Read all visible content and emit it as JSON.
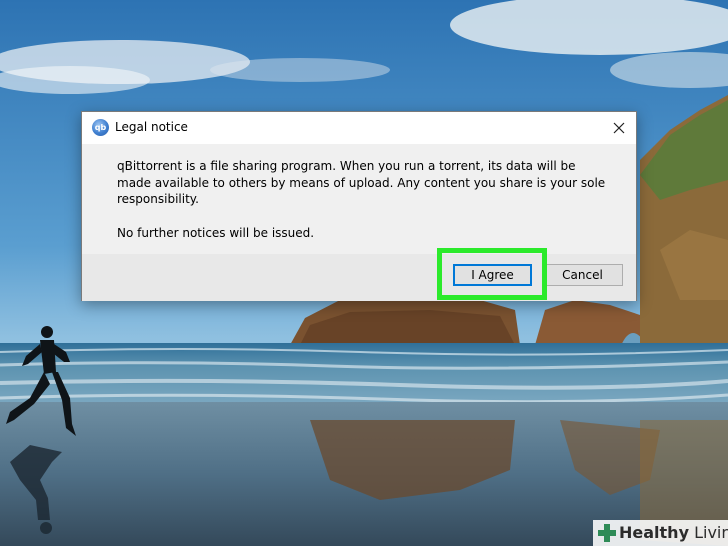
{
  "dialog": {
    "title": "Legal notice",
    "app_icon_text": "qb",
    "message": "qBittorrent is a file sharing program. When you run a torrent, its data will be made available to others by means of upload. Any content you share is your sole responsibility.",
    "notice": "No further notices will be issued.",
    "agree_label": "I Agree",
    "cancel_label": "Cancel"
  },
  "watermark": {
    "part1": "Healthy",
    "part2": " Living"
  },
  "colors": {
    "highlight": "#2bea2b",
    "focus_border": "#0078d7",
    "watermark_cross": "#2e8b57"
  }
}
